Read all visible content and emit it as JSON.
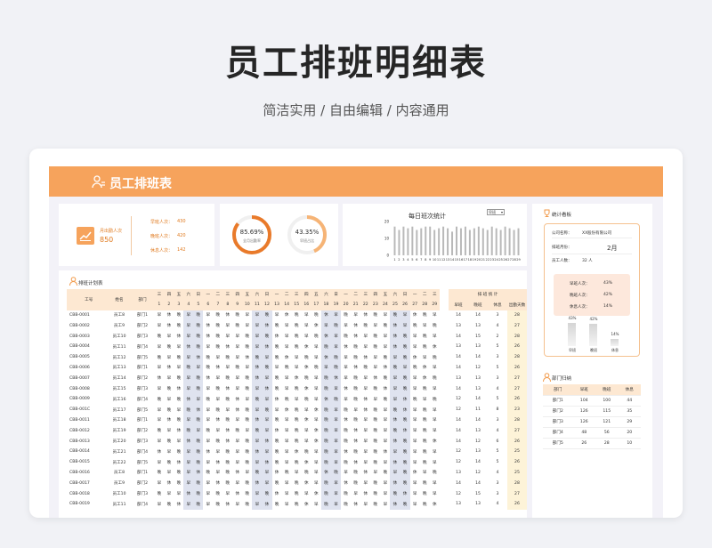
{
  "hero": {
    "title": "员工排班明细表",
    "subtitle": "简洁实用 / 自由编辑 / 内容通用"
  },
  "banner": {
    "title": "员工排班表"
  },
  "summary": {
    "month_people_label": "月出勤人次",
    "month_people_value": "850",
    "rows": [
      {
        "label": "早班人次：",
        "value": "430"
      },
      {
        "label": "晚班人次：",
        "value": "420"
      },
      {
        "label": "休息人次：",
        "value": "142"
      }
    ]
  },
  "donuts": [
    {
      "pct": "85.69%",
      "caption": "全月出勤率",
      "value": 0.8569,
      "color": "#e97a2a"
    },
    {
      "pct": "43.35%",
      "caption": "早班占比",
      "value": 0.4335,
      "color": "#f6b476"
    }
  ],
  "daily_chart": {
    "title": "每日班次统计",
    "selector": "早班",
    "y_ticks": [
      "20",
      "10",
      "0"
    ],
    "x_labels": [
      "1",
      "2",
      "3",
      "4",
      "5",
      "6",
      "7",
      "8",
      "9",
      "10",
      "11",
      "12",
      "13",
      "14",
      "15",
      "16",
      "17",
      "18",
      "19",
      "20",
      "21",
      "22",
      "23",
      "24",
      "25",
      "26",
      "27",
      "28",
      "29"
    ]
  },
  "chart_data": {
    "type": "bar",
    "title": "每日班次统计",
    "categories": [
      "1",
      "2",
      "3",
      "4",
      "5",
      "6",
      "7",
      "8",
      "9",
      "10",
      "11",
      "12",
      "13",
      "14",
      "15",
      "16",
      "17",
      "18",
      "19",
      "20",
      "21",
      "22",
      "23",
      "24",
      "25",
      "26",
      "27",
      "28",
      "29"
    ],
    "values": [
      17,
      15,
      17,
      16,
      17,
      15,
      16,
      17,
      17,
      15,
      16,
      17,
      16,
      14,
      17,
      16,
      17,
      15,
      16,
      17,
      16,
      15,
      17,
      16,
      15,
      17,
      16,
      15,
      16
    ],
    "ylim": [
      0,
      20
    ]
  },
  "schedule": {
    "title": "排班计划表",
    "col_id": "工号",
    "col_name": "姓名",
    "col_dept": "部门",
    "weekdays": [
      "三",
      "四",
      "五",
      "六",
      "日",
      "一",
      "二",
      "三",
      "四",
      "五",
      "六",
      "日",
      "一",
      "二",
      "三",
      "四",
      "五",
      "六",
      "日",
      "一",
      "二",
      "三",
      "四",
      "五",
      "六",
      "日",
      "一",
      "二",
      "三"
    ],
    "days": [
      "1",
      "2",
      "3",
      "4",
      "5",
      "6",
      "7",
      "8",
      "9",
      "10",
      "11",
      "12",
      "13",
      "14",
      "15",
      "16",
      "17",
      "18",
      "19",
      "20",
      "21",
      "22",
      "23",
      "24",
      "25",
      "26",
      "27",
      "28",
      "29"
    ],
    "stats_group": "排 班 统 计",
    "stat_cols": [
      "早班",
      "晚班",
      "休息",
      "出勤天数"
    ],
    "rows": [
      {
        "id": "CBB-0001",
        "name": "员工8",
        "dept": "部门1",
        "s": "早休晚早晚早晚休晚早早晚早休晚早晚休早晚早休晚早晚早休晚早",
        "stats": [
          "14",
          "14",
          "3",
          "28"
        ]
      },
      {
        "id": "CBB-0002",
        "name": "员工9",
        "dept": "部门2",
        "s": "早休晚早晚休晚早晚早早休晚早晚早休早晚早休晚早晚休早晚早晚",
        "stats": [
          "13",
          "13",
          "4",
          "27"
        ]
      },
      {
        "id": "CBB-0003",
        "name": "员工10",
        "dept": "部门3",
        "s": "晚早休早晚休晚早早晚早晚休早晚早晚休早晚休早晚早休晚早晚早",
        "stats": [
          "14",
          "15",
          "2",
          "28"
        ]
      },
      {
        "id": "CBB-0004",
        "name": "员工11",
        "dept": "部门4",
        "s": "早晚早休晚早晚休早晚早休晚早晚休早晚早休晚早晚早休晚早晚休",
        "stats": [
          "13",
          "13",
          "5",
          "26"
        ]
      },
      {
        "id": "CBB-0005",
        "name": "员工12",
        "dept": "部门5",
        "s": "晚早晚早休晚早晚早休晚早晚休早晚早休晚早晚休早晚早晚休早晚",
        "stats": [
          "14",
          "14",
          "3",
          "28"
        ]
      },
      {
        "id": "CBB-0006",
        "name": "员工13",
        "dept": "部门1",
        "s": "早休早晚早晚休早晚早休晚早晚早休晚早晚早休晚早休晚早晚休早",
        "stats": [
          "14",
          "12",
          "5",
          "26"
        ]
      },
      {
        "id": "CBB-0007",
        "name": "员工14",
        "dept": "部门2",
        "s": "休早晚早晚休早晚早晚休早晚早休晚早晚休早晚早休晚早晚早休晚",
        "stats": [
          "13",
          "13",
          "3",
          "27"
        ]
      },
      {
        "id": "CBB-0008",
        "name": "员工15",
        "dept": "部门3",
        "s": "早晚休早晚早晚休早晚早休晚早晚休早晚早休晚早晚休早晚早晚早",
        "stats": [
          "14",
          "13",
          "4",
          "27"
        ]
      },
      {
        "id": "CBB-0009",
        "name": "员工16",
        "dept": "部门4",
        "s": "晚早晚休早晚早晚休早晚早休晚早晚早休晚早晚休早晚早休晚早晚",
        "stats": [
          "12",
          "14",
          "5",
          "26"
        ]
      },
      {
        "id": "CBB-001C",
        "name": "员工17",
        "dept": "部门5",
        "s": "早晚早晚休早晚早休晚早晚早休晚早休晚早晚早休晚早晚休早晚早",
        "stats": [
          "12",
          "11",
          "8",
          "23"
        ]
      },
      {
        "id": "CBB-0011",
        "name": "员工18",
        "dept": "部门1",
        "s": "早休晚早晚早休晚早晚休早晚早晚休早晚早休晚早晚早休晚早晚早",
        "stats": [
          "14",
          "14",
          "3",
          "28"
        ]
      },
      {
        "id": "CBB-0012",
        "name": "员工19",
        "dept": "部门2",
        "s": "晚早休晚早晚早休晚早晚早休早晚早休晚早晚休早晚早晚休早晚早",
        "stats": [
          "14",
          "13",
          "4",
          "27"
        ]
      },
      {
        "id": "CBB-0013",
        "name": "员工20",
        "dept": "部门3",
        "s": "早晚早休晚早晚休早晚早休晚早晚早休晚早晚休早晚早休晚早晚休",
        "stats": [
          "14",
          "12",
          "6",
          "26"
        ]
      },
      {
        "id": "CBB-0014",
        "name": "员工21",
        "dept": "部门4",
        "s": "休早晚早晚休早晚早晚休早晚早休晚早晚早休晚早晚休早晚早晚早",
        "stats": [
          "12",
          "13",
          "5",
          "25"
        ]
      },
      {
        "id": "CBB-0015",
        "name": "员工22",
        "dept": "部门5",
        "s": "早晚休早晚早休晚早晚早休晚早晚休早晚早晚休早晚早休晚早晚早",
        "stats": [
          "12",
          "14",
          "5",
          "26"
        ]
      },
      {
        "id": "CBB-0016",
        "name": "员工8",
        "dept": "部门1",
        "s": "晚早晚早休晚早晚休早晚早休晚早晚早休晚早晚休早晚早晚休早晚",
        "stats": [
          "13",
          "12",
          "4",
          "25"
        ]
      },
      {
        "id": "CBB-0017",
        "name": "员工9",
        "dept": "部门2",
        "s": "早休晚早晚早休晚早晚休早晚早晚休早晚早休晚早晚早休晚早晚早",
        "stats": [
          "14",
          "14",
          "3",
          "28"
        ]
      },
      {
        "id": "CBB-0018",
        "name": "员工10",
        "dept": "部门3",
        "s": "晚早早休晚早晚早休晚早晚休早晚早休晚早晚早休晚早晚休早晚早",
        "stats": [
          "12",
          "15",
          "3",
          "27"
        ]
      },
      {
        "id": "CBB-0019",
        "name": "员工11",
        "dept": "部门4",
        "s": "早晚休早晚早晚休早晚早休晚早晚休早晚早晚休早晚早休晚早晚休",
        "stats": [
          "13",
          "13",
          "4",
          "26"
        ]
      }
    ]
  },
  "right_panel": {
    "title": "统计看板",
    "company_label": "公司名称：",
    "company_value": "XX股份有限公司",
    "month_label": "排班月份：",
    "month_value": "2月",
    "staff_label": "员工人数：",
    "staff_value": "32 人",
    "ratios": [
      {
        "label": "早班人次：",
        "value": "43%"
      },
      {
        "label": "晚班人次：",
        "value": "42%"
      },
      {
        "label": "休息人次：",
        "value": "14%"
      }
    ],
    "bars": [
      {
        "label": "早班",
        "pct": "43%",
        "value": 0.43
      },
      {
        "label": "晚班",
        "pct": "42%",
        "value": 0.42
      },
      {
        "label": "休息",
        "pct": "14%",
        "value": 0.14
      }
    ]
  },
  "dept_panel": {
    "title": "部门归纳",
    "cols": [
      "部门",
      "早班",
      "晚班",
      "休息"
    ],
    "rows": [
      [
        "部门1",
        "104",
        "100",
        "44"
      ],
      [
        "部门2",
        "126",
        "115",
        "35"
      ],
      [
        "部门3",
        "126",
        "121",
        "29"
      ],
      [
        "部门4",
        "48",
        "56",
        "20"
      ],
      [
        "部门5",
        "26",
        "28",
        "10"
      ]
    ]
  },
  "colors": {
    "accent": "#f6a35c",
    "header": "#fde8d2",
    "shade": "#dfe3ef"
  }
}
